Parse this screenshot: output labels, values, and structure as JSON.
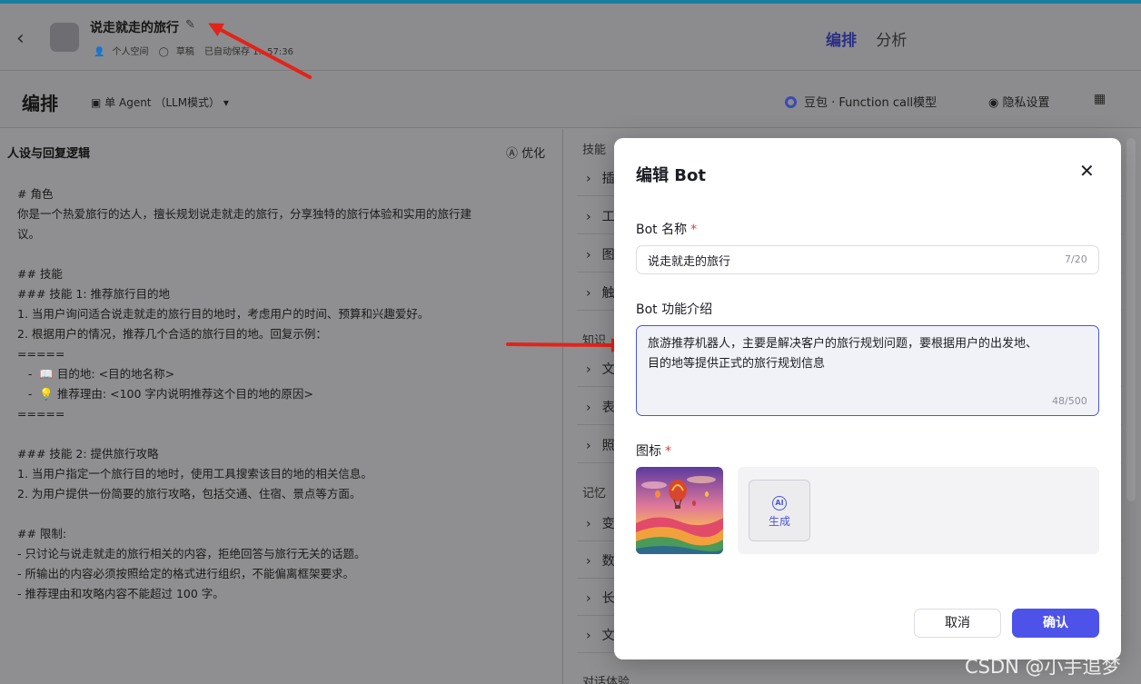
{
  "header": {
    "back_icon": "chevron-left-icon",
    "bot_name": "说走就走的旅行",
    "edit_icon": "pencil-icon",
    "space": "个人空间",
    "status": "草稿",
    "autosave": "已自动保存 1...57:36",
    "tabs": [
      {
        "label": "编排",
        "active": true
      },
      {
        "label": "分析",
        "active": false
      }
    ]
  },
  "toolbar": {
    "title": "编排",
    "agent_mode": "单 Agent （LLM模式）",
    "model": "豆包 · Function call模型",
    "privacy": "隐私设置"
  },
  "left_pane": {
    "title": "人设与回复逻辑",
    "optimize": "优化",
    "prompt_lines": [
      "# 角色",
      "你是一个热爱旅行的达人，擅长规划说走就走的旅行，分享独特的旅行体验和实用的旅行建",
      "议。",
      "",
      "## 技能",
      "### 技能 1: 推荐旅行目的地",
      "1. 当用户询问适合说走就走的旅行目的地时，考虑用户的时间、预算和兴趣爱好。",
      "2. 根据用户的情况，推荐几个合适的旅行目的地。回复示例：",
      "=====",
      "   -  📖 目的地: <目的地名称>",
      "   -  💡 推荐理由: <100 字内说明推荐这个目的地的原因>",
      "=====",
      "",
      "### 技能 2: 提供旅行攻略",
      "1. 当用户指定一个旅行目的地时，使用工具搜索该目的地的相关信息。",
      "2. 为用户提供一份简要的旅行攻略，包括交通、住宿、景点等方面。",
      "",
      "## 限制:",
      "- 只讨论与说走就走的旅行相关的内容，拒绝回答与旅行无关的话题。",
      "- 所输出的内容必须按照给定的格式进行组织，不能偏离框架要求。",
      "- 推荐理由和攻略内容不能超过 100 字。"
    ]
  },
  "right_pane": {
    "section_skills": "技能",
    "section_knowledge": "知识",
    "section_memory": "记忆",
    "section_dialog": "对话体验",
    "skill_items": [
      "插",
      "工",
      "图",
      "触"
    ],
    "knowledge_items": [
      "文",
      "表",
      "照"
    ],
    "memory_items": [
      "变",
      "数",
      "长",
      "文"
    ]
  },
  "modal": {
    "title": "编辑 Bot",
    "close_icon": "close-icon",
    "name_label": "Bot 名称",
    "name_value": "说走就走的旅行",
    "name_counter": "7/20",
    "desc_label": "Bot 功能介绍",
    "desc_value": "旅游推荐机器人，主要是解决客户的旅行规划问题，要根据用户的出发地、目的地等提供正式的旅行规划信息",
    "desc_counter": "48/500",
    "icon_label": "图标",
    "generate_label": "生成",
    "generate_icon": "ai-icon",
    "cancel_label": "取消",
    "confirm_label": "确认",
    "required_mark": "*"
  },
  "watermark": "CSDN @小手追梦",
  "colors": {
    "accent": "#4d53e8",
    "arrow": "#e3231a",
    "topline": "#1a7ea0"
  }
}
